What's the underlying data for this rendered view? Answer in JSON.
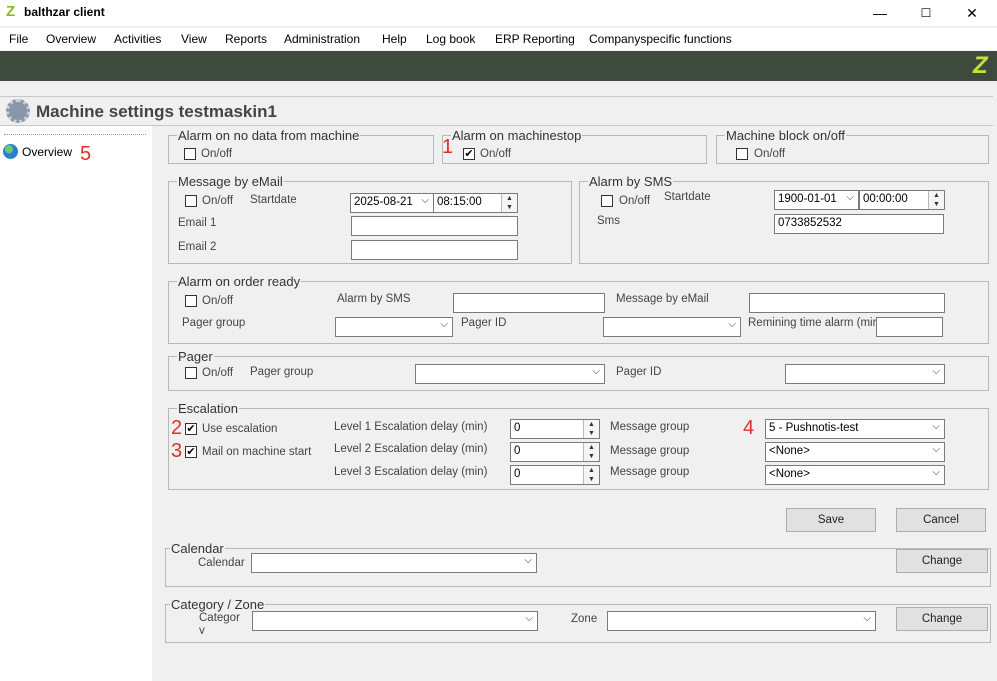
{
  "app": {
    "title": "balthzar client",
    "logo": "Z"
  },
  "window_controls": {
    "minimize": "—",
    "maximize": "☐",
    "close": "✕"
  },
  "menu": [
    "File",
    "Overview",
    "Activities",
    "View",
    "Reports",
    "Administration",
    "Help",
    "Log book",
    "ERP Reporting",
    "Companyspecific functions"
  ],
  "page": {
    "title": "Machine settings testmaskin1"
  },
  "nav": {
    "overview": "Overview"
  },
  "markers": {
    "m1": "1",
    "m2": "2",
    "m3": "3",
    "m4": "4",
    "m5": "5"
  },
  "alarm_no_data": {
    "legend": "Alarm on no data from machine",
    "onoff": "On/off"
  },
  "alarm_machinestop": {
    "legend": "Alarm on machinestop",
    "onoff": "On/off",
    "checked": "✔"
  },
  "machine_block": {
    "legend": "Machine block on/off",
    "onoff": "On/off"
  },
  "email": {
    "legend": "Message by eMail",
    "onoff": "On/off",
    "startdate_label": "Startdate",
    "date": "2025-08-21",
    "time": "08:15:00",
    "email1_label": "Email 1",
    "email2_label": "Email 2",
    "email1": "",
    "email2": ""
  },
  "sms": {
    "legend": "Alarm by SMS",
    "onoff": "On/off",
    "startdate_label": "Startdate",
    "date": "1900-01-01",
    "time": "00:00:00",
    "sms_label": "Sms",
    "sms_value": "0733852532"
  },
  "order_ready": {
    "legend": "Alarm on order ready",
    "onoff": "On/off",
    "alarm_sms_label": "Alarm by SMS",
    "message_email_label": "Message by eMail",
    "pager_group_label": "Pager group",
    "pager_id_label": "Pager ID",
    "remaining_label": "Remining time alarm (min"
  },
  "pager": {
    "legend": "Pager",
    "onoff": "On/off",
    "pager_group_label": "Pager group",
    "pager_id_label": "Pager ID"
  },
  "escalation": {
    "legend": "Escalation",
    "use_label": "Use escalation",
    "mail_label": "Mail on machine start",
    "checked": "✔",
    "levels": [
      {
        "label": "Level 1 Escalation delay (min)",
        "value": "0",
        "msg_label": "Message group",
        "group": "5 - Pushnotis-test"
      },
      {
        "label": "Level 2 Escalation delay (min)",
        "value": "0",
        "msg_label": "Message group",
        "group": "<None>"
      },
      {
        "label": "Level 3 Escalation delay (min)",
        "value": "0",
        "msg_label": "Message group",
        "group": "<None>"
      }
    ]
  },
  "buttons": {
    "save": "Save",
    "cancel": "Cancel",
    "change1": "Change",
    "change2": "Change"
  },
  "calendar": {
    "legend": "Calendar",
    "label": "Calendar"
  },
  "category_zone": {
    "legend": "Category / Zone",
    "category_label": "Categor\ny",
    "zone_label": "Zone"
  },
  "icons": {
    "chevron": "⌵",
    "spin_up": "▲",
    "spin_down": "▼"
  }
}
